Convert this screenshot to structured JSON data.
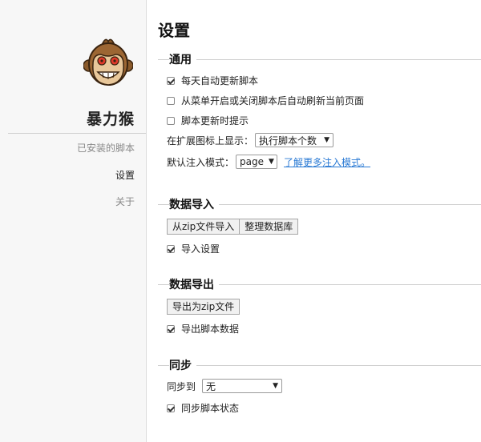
{
  "sidebar": {
    "brand": "暴力猴",
    "nav": [
      {
        "label": "已安装的脚本",
        "active": false
      },
      {
        "label": "设置",
        "active": true
      },
      {
        "label": "关于",
        "active": false
      }
    ]
  },
  "main": {
    "title": "设置",
    "general": {
      "title": "通用",
      "auto_update": {
        "label": "每天自动更新脚本",
        "checked": true
      },
      "refresh_on_toggle": {
        "label": "从菜单开启或关闭脚本后自动刷新当前页面",
        "checked": false
      },
      "notify_update": {
        "label": "脚本更新时提示",
        "checked": false
      },
      "badge": {
        "label": "在扩展图标上显示：",
        "value": "执行脚本个数"
      },
      "inject": {
        "label": "默认注入模式：",
        "value": "page",
        "link": "了解更多注入模式。"
      }
    },
    "import": {
      "title": "数据导入",
      "from_zip": "从zip文件导入",
      "vacuum": "整理数据库",
      "import_settings": {
        "label": "导入设置",
        "checked": true
      }
    },
    "export": {
      "title": "数据导出",
      "to_zip": "导出为zip文件",
      "export_values": {
        "label": "导出脚本数据",
        "checked": true
      }
    },
    "sync": {
      "title": "同步",
      "sync_to_label": "同步到",
      "sync_to_value": "无",
      "sync_state": {
        "label": "同步脚本状态",
        "checked": true
      }
    }
  }
}
